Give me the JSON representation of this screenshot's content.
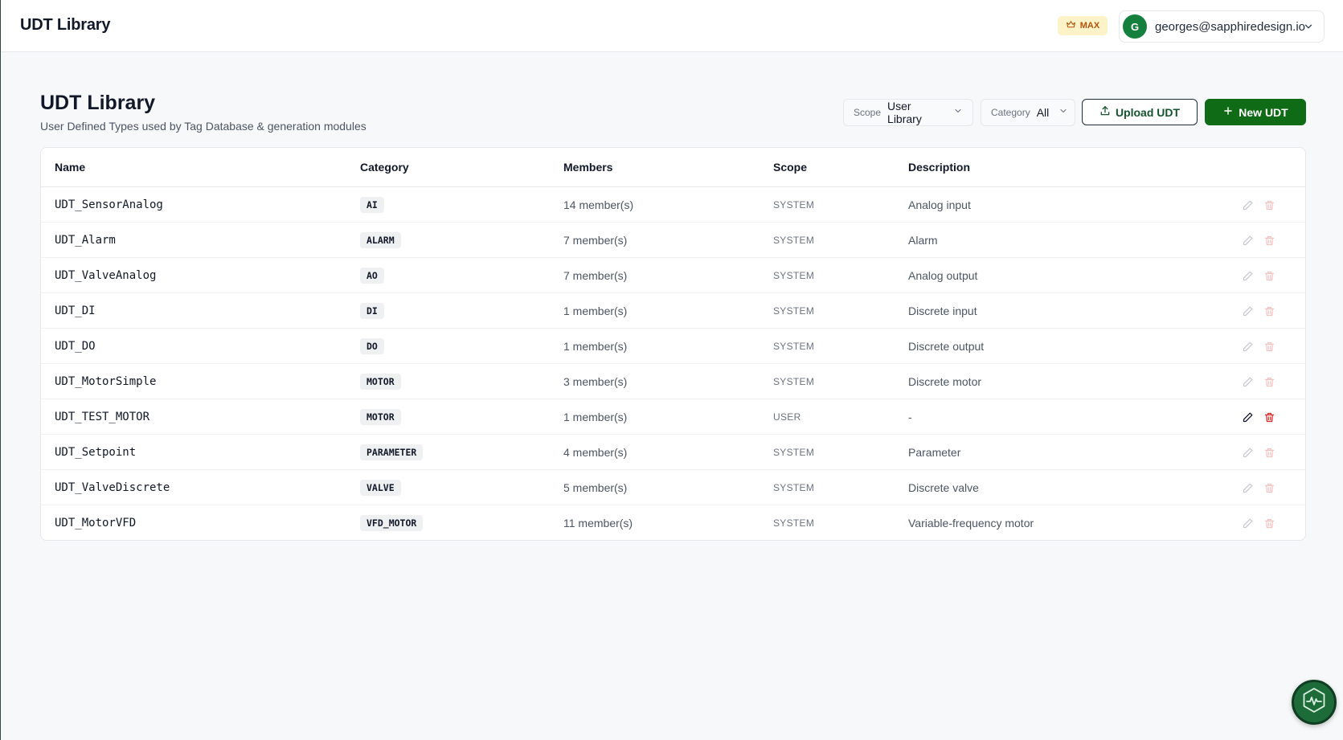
{
  "header": {
    "app_title": "UDT Library",
    "plan_badge": "MAX",
    "user": {
      "avatar_initial": "G",
      "email": "georges@sapphiredesign.io"
    }
  },
  "page": {
    "title": "UDT Library",
    "subtitle": "User Defined Types used by Tag Database & generation modules"
  },
  "filters": {
    "scope": {
      "label": "Scope",
      "value": "User Library"
    },
    "category": {
      "label": "Category",
      "value": "All"
    }
  },
  "actions": {
    "upload_label": "Upload UDT",
    "new_label": "New UDT"
  },
  "table": {
    "columns": {
      "name": "Name",
      "category": "Category",
      "members": "Members",
      "scope": "Scope",
      "description": "Description"
    },
    "rows": [
      {
        "name": "UDT_SensorAnalog",
        "category": "AI",
        "members": "14 member(s)",
        "scope": "SYSTEM",
        "description": "Analog input"
      },
      {
        "name": "UDT_Alarm",
        "category": "ALARM",
        "members": "7 member(s)",
        "scope": "SYSTEM",
        "description": "Alarm"
      },
      {
        "name": "UDT_ValveAnalog",
        "category": "AO",
        "members": "7 member(s)",
        "scope": "SYSTEM",
        "description": "Analog output"
      },
      {
        "name": "UDT_DI",
        "category": "DI",
        "members": "1 member(s)",
        "scope": "SYSTEM",
        "description": "Discrete input"
      },
      {
        "name": "UDT_DO",
        "category": "DO",
        "members": "1 member(s)",
        "scope": "SYSTEM",
        "description": "Discrete output"
      },
      {
        "name": "UDT_MotorSimple",
        "category": "MOTOR",
        "members": "3 member(s)",
        "scope": "SYSTEM",
        "description": "Discrete motor"
      },
      {
        "name": "UDT_TEST_MOTOR",
        "category": "MOTOR",
        "members": "1 member(s)",
        "scope": "USER",
        "description": "-"
      },
      {
        "name": "UDT_Setpoint",
        "category": "PARAMETER",
        "members": "4 member(s)",
        "scope": "SYSTEM",
        "description": "Parameter"
      },
      {
        "name": "UDT_ValveDiscrete",
        "category": "VALVE",
        "members": "5 member(s)",
        "scope": "SYSTEM",
        "description": "Discrete valve"
      },
      {
        "name": "UDT_MotorVFD",
        "category": "VFD_MOTOR",
        "members": "11 member(s)",
        "scope": "SYSTEM",
        "description": "Variable-frequency motor"
      }
    ]
  },
  "icons": {
    "plan": "crown-icon",
    "user_menu": "chevron-down-icon",
    "upload": "upload-icon",
    "new": "plus-icon",
    "row_edit": "pencil-icon",
    "row_delete": "trash-icon",
    "assistant": "assistant-logo-icon"
  },
  "colors": {
    "primary": "#0f6b16",
    "badge_bg": "#fdf3c8",
    "badge_text": "#b45309",
    "delete": "#dc2626"
  }
}
